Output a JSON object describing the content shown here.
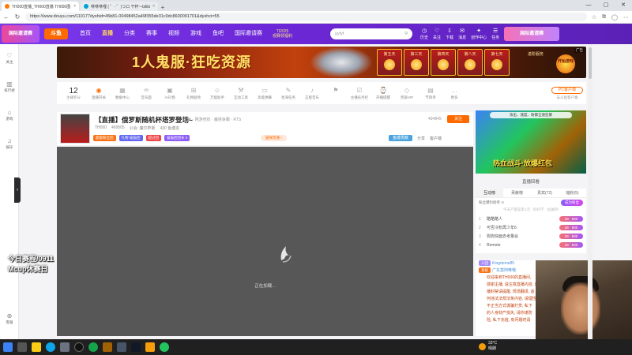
{
  "browser": {
    "tabs": [
      {
        "title": "TH000直播_TH000直播 TH000图",
        "active": true
      },
      {
        "title": "咻咻咻哩 ( ゜- ゜)つロ 干杯~-bilibi",
        "active": false
      }
    ],
    "url": "https://www.douyu.com/110177dyshid=45b81-00498452a49f355de31c0dc8600091701&dyshci=55"
  },
  "site": {
    "promo_left": "国际邀请赛",
    "logo": "斗鱼",
    "nav": [
      "首页",
      "直播",
      "分类",
      "赛事",
      "视频",
      "游戏",
      "鱼吧",
      "国际邀请赛"
    ],
    "nav_active_index": 1,
    "ti_badge": {
      "line1": "TI2025",
      "line2": "观赛领福利"
    },
    "search_value": "yyfyf",
    "header_icons": [
      {
        "icon": "history-icon",
        "glyph": "◷",
        "label": "历史"
      },
      {
        "icon": "follow-icon",
        "glyph": "♡",
        "label": "关注"
      },
      {
        "icon": "download-icon",
        "glyph": "⇩",
        "label": "下载"
      },
      {
        "icon": "news-icon",
        "glyph": "✉",
        "label": "消息"
      },
      {
        "icon": "creator-icon",
        "glyph": "✦",
        "label": "创作中心"
      },
      {
        "icon": "task-icon",
        "glyph": "☰",
        "label": "任务"
      }
    ],
    "openlive_label": "国际邀请赛"
  },
  "left_sidebar": [
    {
      "icon": "heart-icon",
      "glyph": "♡",
      "label": "关注"
    },
    {
      "icon": "rank-icon",
      "glyph": "▥",
      "label": "排行榜"
    },
    {
      "icon": "game-icon",
      "glyph": "⌂",
      "label": "游戏"
    },
    {
      "icon": "entertainment-icon",
      "glyph": "♫",
      "label": "娱乐"
    }
  ],
  "left_sidebar_bottom": {
    "icon": "client-icon",
    "glyph": "⊕",
    "label": "客服"
  },
  "overlay_text": [
    "今日赛程/0911",
    "Mcup休赛日"
  ],
  "banner": {
    "title": "1人鬼服·狂吃资源",
    "days": [
      "第五天",
      "第三天",
      "第四天",
      "第八天",
      "第七天"
    ],
    "cta_line": "进阶服务",
    "cta_button": "开始游戏",
    "tag": "广告"
  },
  "toolbar": {
    "count": "12",
    "count_label": "主播积分",
    "items": [
      {
        "glyph": "◉",
        "label": "直播开关",
        "hot": true
      },
      {
        "glyph": "▦",
        "label": "数据中心",
        "hot": false
      },
      {
        "glyph": "♒",
        "label": "音乐面",
        "hot": false
      },
      {
        "glyph": "▣",
        "label": "AI礼物",
        "hot": false
      },
      {
        "glyph": "⊞",
        "label": "礼物剧场",
        "hot": false
      },
      {
        "glyph": "☺",
        "label": "万能助手",
        "hot": false
      },
      {
        "glyph": "⚒",
        "label": "互动工具",
        "hot": false
      },
      {
        "glyph": "▭",
        "label": "高能弹幕",
        "hot": false
      },
      {
        "glyph": "✎",
        "label": "星海任务",
        "hot": false
      },
      {
        "glyph": "♪",
        "label": "正版音乐",
        "hot": false
      },
      {
        "glyph": "⚑",
        "label": "",
        "hot": false
      },
      {
        "glyph": "☑",
        "label": "主播任务栏",
        "hot": false
      },
      {
        "glyph": "⌚",
        "label": "开播提醒",
        "hot": false
      },
      {
        "glyph": "◇",
        "label": "贵族VIP",
        "hot": false
      },
      {
        "glyph": "▤",
        "label": "节目单",
        "hot": false
      },
      {
        "glyph": "…",
        "label": "更多",
        "hot": false
      }
    ],
    "pc_button": "PC客户端",
    "pc_sub": "去斗鱼客户端"
  },
  "stream": {
    "title": "【直播】俄罗斯随机杯塔罗登场~",
    "category": "单板 · 网游竞技 · 魔塔争霸 · RTS",
    "streamer": "TH000",
    "heat": "469505",
    "announcement": "公会: 魔尔萨斯",
    "viewers": "430 鱼塘友",
    "fans": "494849",
    "follow_label": "关注",
    "badges": [
      {
        "text": "超级粉丝团",
        "color": "#f97316"
      },
      {
        "text": "礼物·猫猫团",
        "color": "#6366f1"
      },
      {
        "text": "超过团",
        "color": "#ef4444"
      },
      {
        "text": "猫猫团团长 0",
        "color": "#8b5cf6"
      }
    ],
    "right_tag": "猫咪普通 ›",
    "actions": [
      "鱼塘贡献",
      "分享",
      "客户端"
    ]
  },
  "player": {
    "loading_text": "正在加载..."
  },
  "ad": {
    "top_text": "攻击、速度、防御全速狂暴",
    "caption": "热血战斗·放爆红包"
  },
  "replay_label": "直播回看",
  "right_tabs": [
    "互动榜",
    "贡献榜",
    "贵宾(72)",
    "轴粉(5)"
  ],
  "right_tab_active": 0,
  "rank": {
    "head_left": "粉丝爆料榜单 ⊙",
    "head_btn": "成为粉丝",
    "tip": "今天产量是第1次 · 好好学 · 加油吧!",
    "rows": [
      {
        "no": "1",
        "name": "酷酷酷人",
        "level": "28 · 600"
      },
      {
        "no": "2",
        "name": "可否冷粉再少年6",
        "level": "28 · 600"
      },
      {
        "no": "3",
        "name": "狗狗快面去考量会",
        "level": "28 · 600"
      },
      {
        "no": "4",
        "name": "Remote",
        "level": "28 · 600"
      }
    ]
  },
  "chat": {
    "lines": [
      {
        "pill": "人团",
        "user": "Kingdome85",
        "text": ""
      },
      {
        "pill": "系统",
        "user": "广东莫阿唯哦",
        "text": ""
      }
    ],
    "body": [
      "欢迎来到TH000的直播间,",
      "感谢主播, 请注意直播内容, 请",
      "播封禁请提醒, 现场翻译, 适",
      "何违法法规法条内容, 请理性观",
      "不正当方式谎骗打赏, 私下",
      "的人身财产损失, 请你谨防",
      "险, 私下充值, 有问题时请"
    ]
  },
  "tray": {
    "temp": "33°C",
    "weather": "晴朗"
  }
}
